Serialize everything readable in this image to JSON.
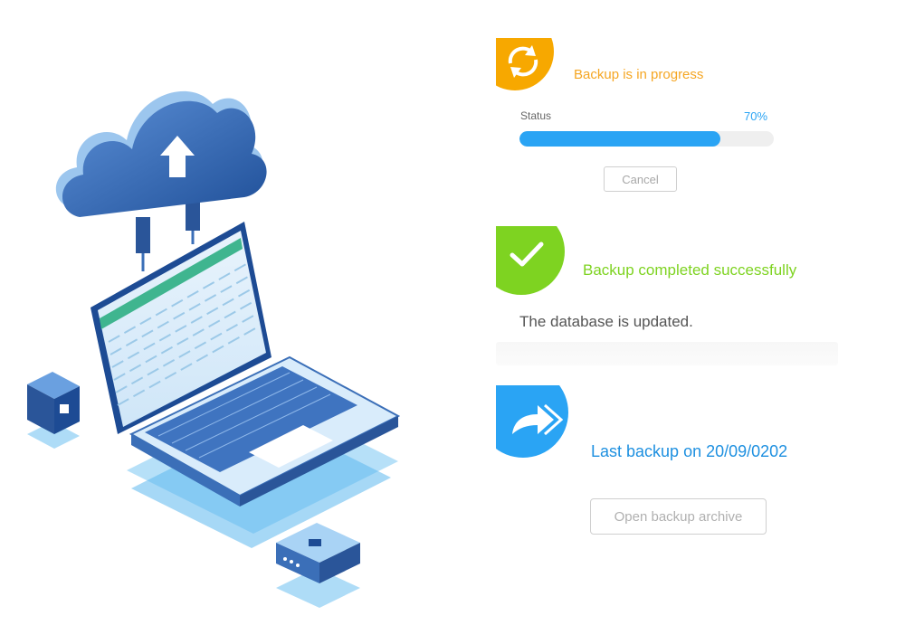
{
  "progress": {
    "title": "Backup is in progress",
    "status_label": "Status",
    "percent_label": "70%",
    "fraction": 0.79,
    "cancel_label": "Cancel",
    "icon": "sync-icon",
    "color": "#f7a800"
  },
  "success": {
    "title": "Backup completed successfully",
    "message": "The database is updated.",
    "icon": "checkmark-icon",
    "color": "#7ed321"
  },
  "archive": {
    "last_backup": "Last backup on 20/09/0202",
    "open_label": "Open backup archive",
    "icon": "forward-arrow-icon",
    "color": "#2aa4f4"
  },
  "illustration": {
    "icons": [
      "cloud-upload-icon",
      "laptop-icon",
      "cube-icon",
      "server-box-icon"
    ]
  }
}
